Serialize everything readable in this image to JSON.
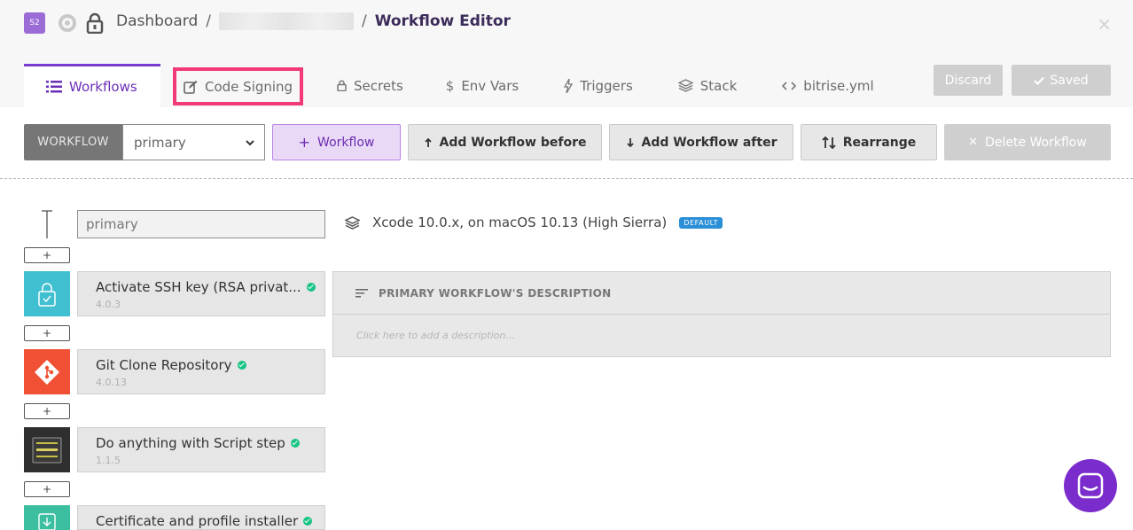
{
  "header": {
    "app_badge": "S2",
    "breadcrumb": {
      "root": "Dashboard",
      "separator": "/",
      "current": "Workflow Editor"
    },
    "close_glyph": "×"
  },
  "tabs": [
    {
      "label": "Workflows",
      "icon": "list-icon",
      "active": true
    },
    {
      "label": "Code Signing",
      "icon": "edit-icon",
      "highlighted": true
    },
    {
      "label": "Secrets",
      "icon": "lock-icon"
    },
    {
      "label": "Env Vars",
      "icon": "dollar-icon"
    },
    {
      "label": "Triggers",
      "icon": "bolt-icon"
    },
    {
      "label": "Stack",
      "icon": "layers-icon"
    },
    {
      "label": "bitrise.yml",
      "icon": "code-icon"
    }
  ],
  "actions": {
    "discard": "Discard",
    "saved": "Saved"
  },
  "toolbar": {
    "workflow_label": "WORKFLOW",
    "selected_workflow": "primary",
    "add": "Workflow",
    "add_before": "Add Workflow before",
    "add_after": "Add Workflow after",
    "rearrange": "Rearrange",
    "delete": "Delete Workflow"
  },
  "workflow": {
    "name": "primary",
    "stack": "Xcode 10.0.x, on macOS 10.13 (High Sierra)",
    "stack_badge": "DEFAULT",
    "description_title": "PRIMARY WORKFLOW'S DESCRIPTION",
    "description_placeholder": "Click here to add a description...",
    "plus": "+",
    "steps": [
      {
        "title": "Activate SSH key (RSA privat...",
        "version": "4.0.3",
        "icon": "ssh-key-icon",
        "color": "#3fbfcf"
      },
      {
        "title": "Git Clone Repository",
        "version": "4.0.13",
        "icon": "git-icon",
        "color": "#f05033"
      },
      {
        "title": "Do anything with Script step",
        "version": "1.1.5",
        "icon": "script-icon",
        "color": "#2f2f2f"
      },
      {
        "title": "Certificate and profile installer",
        "version": "",
        "icon": "certificate-icon",
        "color": "#3cbfa0"
      }
    ]
  },
  "colors": {
    "accent": "#7c3ccf",
    "highlight": "#f23a7a",
    "success": "#17c483"
  }
}
